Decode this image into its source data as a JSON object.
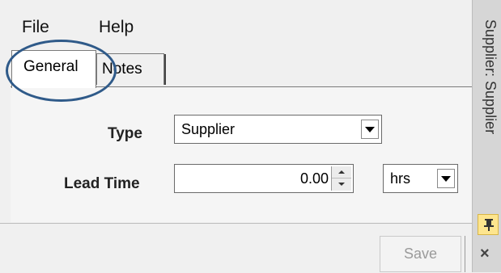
{
  "menu": {
    "file": "File",
    "help": "Help"
  },
  "tabs": [
    {
      "label": "General"
    },
    {
      "label": "Notes"
    }
  ],
  "form": {
    "type_label": "Type",
    "type_value": "Supplier",
    "lead_time_label": "Lead Time",
    "lead_time_value": "0.00",
    "units_value": "hrs"
  },
  "footer": {
    "save_label": "Save"
  },
  "sidepanel": {
    "title": "Supplier: Supplier",
    "close_glyph": "×"
  },
  "colors": {
    "annotation": "#2f5a89",
    "pin_bg": "#fde58e"
  }
}
